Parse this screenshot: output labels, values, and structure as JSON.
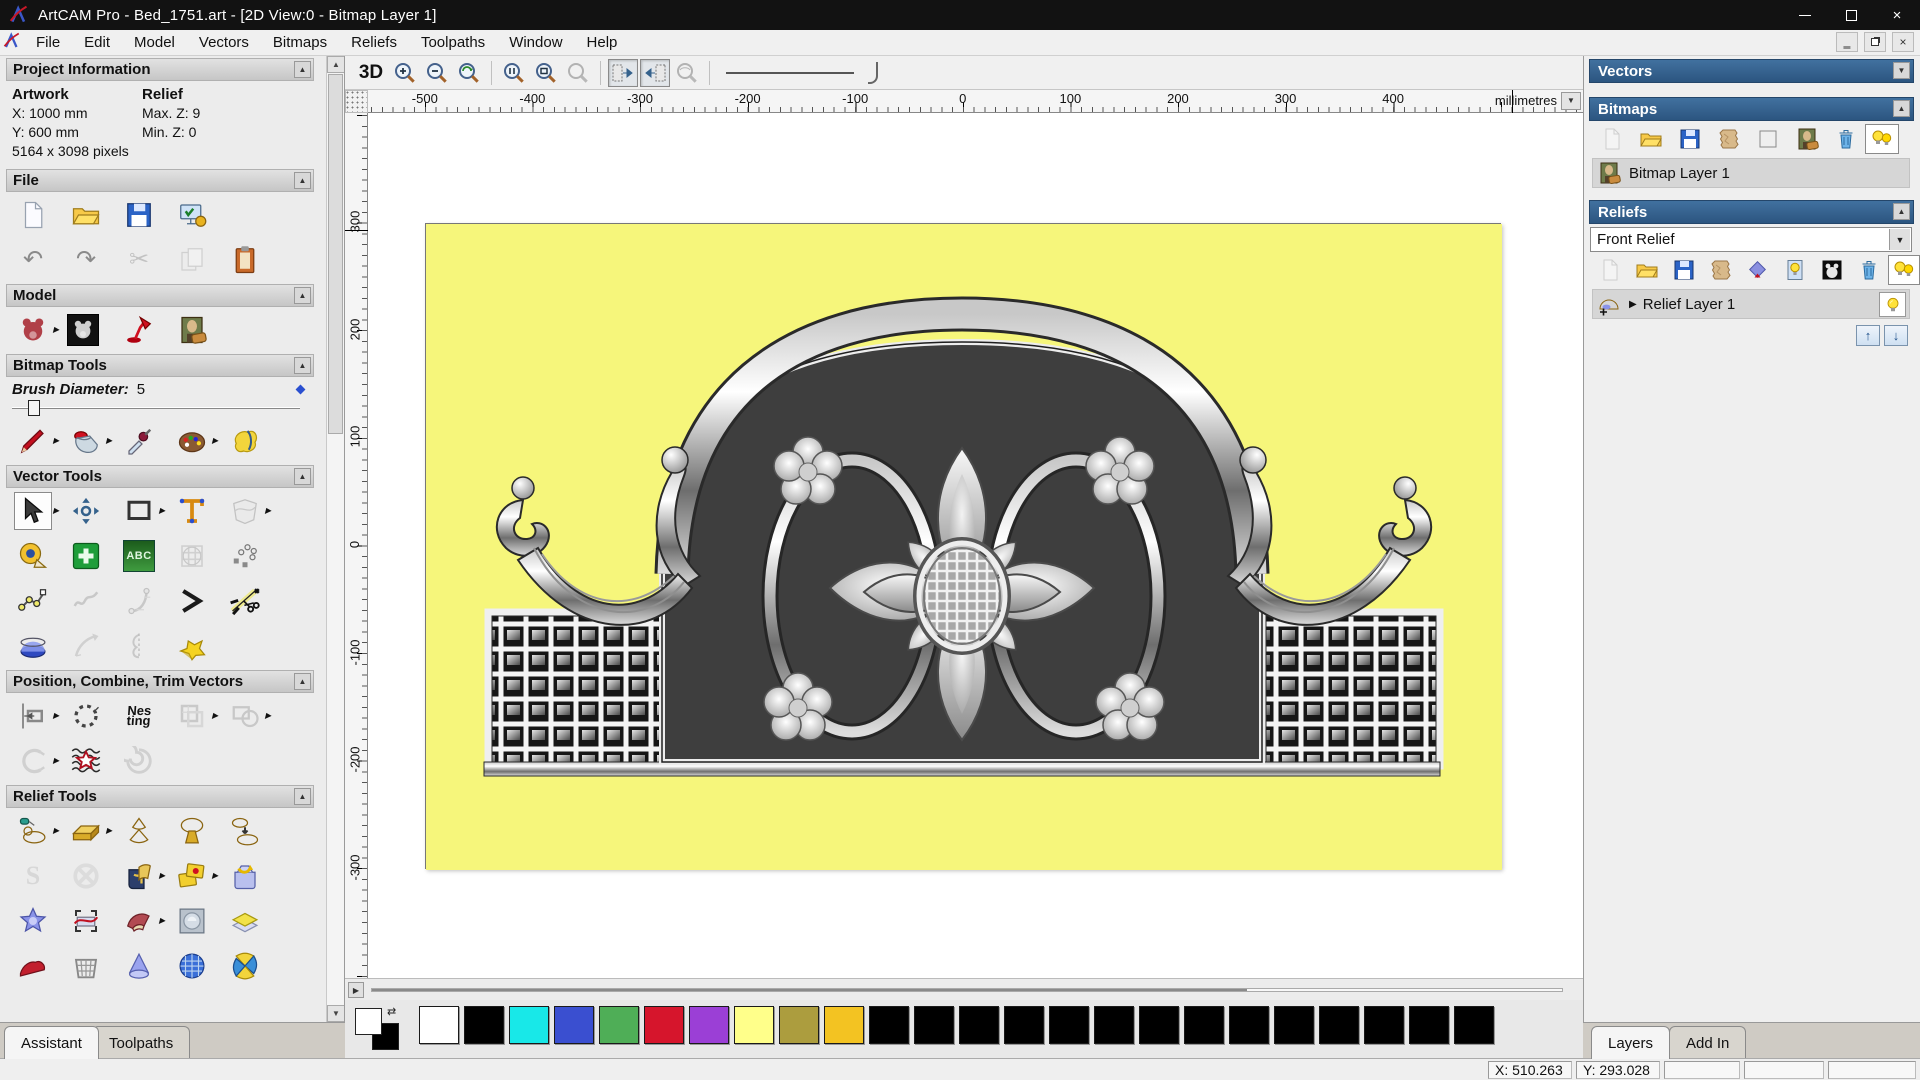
{
  "window": {
    "title": "ArtCAM Pro - Bed_1751.art - [2D View:0 - Bitmap Layer 1]"
  },
  "menu": {
    "items": [
      "File",
      "Edit",
      "Model",
      "Vectors",
      "Bitmaps",
      "Reliefs",
      "Toolpaths",
      "Window",
      "Help"
    ]
  },
  "assistant": {
    "project_info": {
      "title": "Project Information",
      "artwork_heading": "Artwork",
      "artwork_x": "X: 1000 mm",
      "artwork_y": "Y: 600 mm",
      "artwork_pixels": "5164 x 3098 pixels",
      "relief_heading": "Relief",
      "relief_max_z": "Max. Z: 9",
      "relief_min_z": "Min. Z: 0"
    },
    "sections": {
      "file": "File",
      "model": "Model",
      "bitmap_tools": "Bitmap Tools",
      "vector_tools": "Vector Tools",
      "position": "Position, Combine, Trim Vectors",
      "relief_tools": "Relief Tools"
    },
    "brush_label": "Brush Diameter:",
    "brush_value": "5",
    "tab_assistant": "Assistant",
    "tab_toolpaths": "Toolpaths"
  },
  "icons": {
    "undo": "↶",
    "redo": "↷",
    "cut": "✂",
    "abc": "ABC",
    "nesting_top": "Nes",
    "nesting_bottom": "ting",
    "s_tool": "S"
  },
  "view": {
    "btn_3d": "3D",
    "ruler_unit": "millimetres",
    "h_ticks": [
      "-500",
      "-400",
      "-300",
      "-200",
      "-100",
      "0",
      "100",
      "200",
      "300",
      "400"
    ],
    "v_ticks": [
      "300",
      "200",
      "100",
      "0",
      "-100",
      "-200",
      "-300"
    ]
  },
  "layers_panel": {
    "vectors_title": "Vectors",
    "bitmaps_title": "Bitmaps",
    "bitmap_layer": "Bitmap Layer 1",
    "reliefs_title": "Reliefs",
    "relief_combo_value": "Front Relief",
    "relief_layer": "Relief Layer 1",
    "tab_layers": "Layers",
    "tab_addin": "Add In"
  },
  "palette": {
    "colors": [
      "#ffffff",
      "#000000",
      "#18e8e8",
      "#3a4fd0",
      "#4fae57",
      "#d6152c",
      "#9b3fd6",
      "#ffff8a",
      "#ac9d3e",
      "#f3c322",
      "#000000",
      "#000000",
      "#000000",
      "#000000",
      "#000000",
      "#000000",
      "#000000",
      "#000000",
      "#000000",
      "#000000",
      "#000000",
      "#000000",
      "#000000",
      "#000000"
    ]
  },
  "status": {
    "x": "X: 510.263",
    "y": "Y: 293.028"
  },
  "artwork_colors": {
    "canvas_yellow": "#f6f67b",
    "panel_dark": "#3e3e3e",
    "header_blue": "#35618f"
  }
}
